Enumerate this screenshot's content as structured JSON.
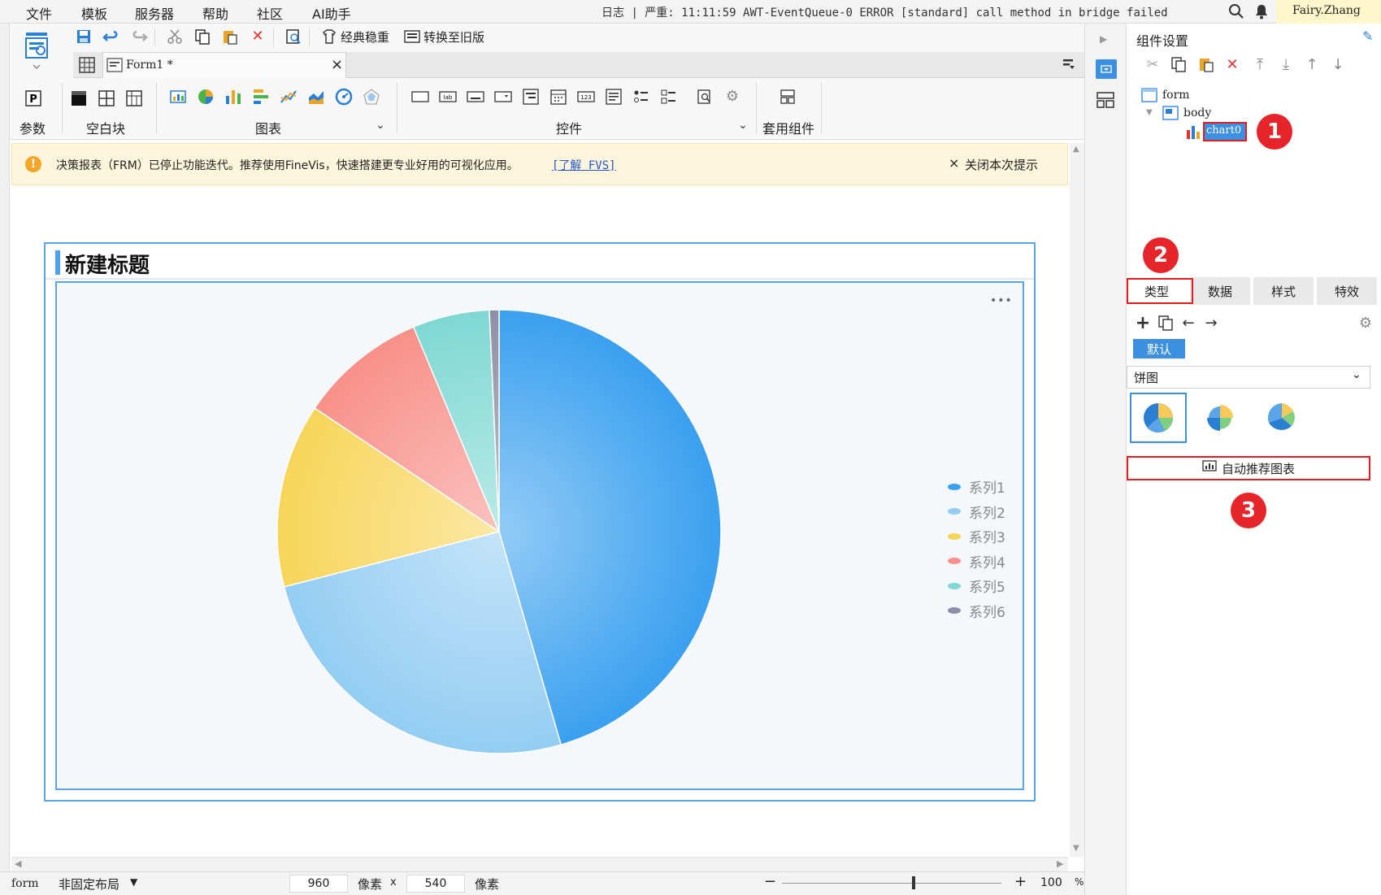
{
  "menubar": {
    "items": [
      "文件",
      "模板",
      "服务器",
      "帮助",
      "社区",
      "AI助手"
    ],
    "log_label": "日志",
    "severity": "严重",
    "log_message": "11:11:59 AWT-EventQueue-0 ERROR [standard] call method in bridge failed",
    "user": "Fairy.Zhang"
  },
  "toolbar": {
    "classic_label": "经典稳重",
    "convert_label": "转换至旧版",
    "groups": {
      "param": "参数",
      "blank": "空白块",
      "chart": "图表",
      "control": "控件",
      "suite": "套用组件"
    }
  },
  "tabs": {
    "form_tab": "Form1 *",
    "close": "×"
  },
  "warning": {
    "text": "决策报表（FRM）已停止功能迭代。推荐使用FineVis，快速搭建更专业好用的可视化应用。",
    "link": "[了解 FVS]",
    "close_label": "关闭本次提示"
  },
  "chart_widget": {
    "title": "新建标题",
    "more": "•••"
  },
  "chart_data": {
    "type": "pie",
    "title": "新建标题",
    "categories": [
      "系列1",
      "系列2",
      "系列3",
      "系列4",
      "系列5",
      "系列6"
    ],
    "values": [
      45.5,
      25.5,
      13.4,
      9.3,
      5.6,
      0.7
    ],
    "colors": [
      "#3aa0ef",
      "#94cdf3",
      "#f7d55a",
      "#f8908a",
      "#7fd8d4",
      "#8e8ea6"
    ],
    "legend_position": "right"
  },
  "statusbar": {
    "form": "form",
    "layout": "非固定布局",
    "width": "960",
    "unit1": "像素",
    "times": "x",
    "height": "540",
    "unit2": "像素",
    "zoom": "100",
    "percent": "%",
    "zoom_level": 0.6
  },
  "right_panel": {
    "title": "组件设置",
    "tree": {
      "root": "form",
      "body": "body",
      "chart": "chart0"
    },
    "tabs": [
      "类型",
      "数据",
      "样式",
      "特效"
    ],
    "default_tag": "默认",
    "chart_type": "饼图",
    "auto_button": "自动推荐图表",
    "badges": [
      "1",
      "2",
      "3"
    ]
  }
}
